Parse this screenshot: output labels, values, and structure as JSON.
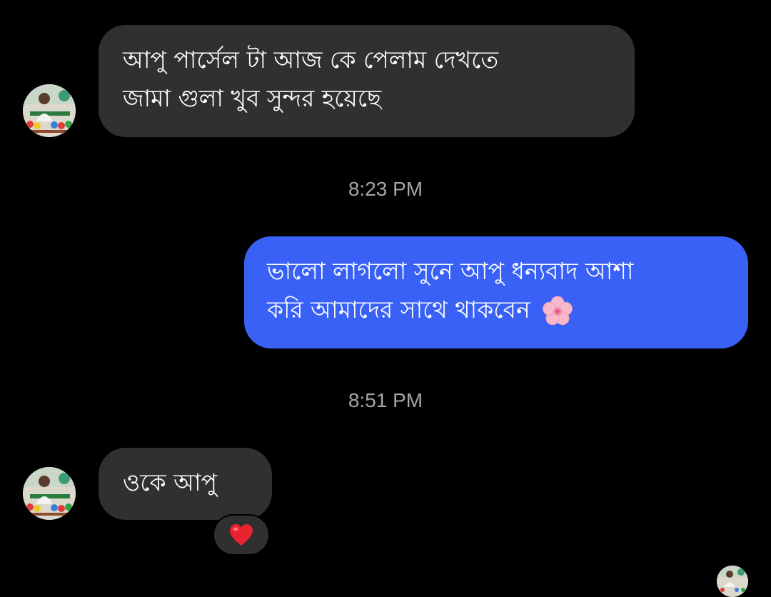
{
  "messages": [
    {
      "direction": "incoming",
      "lines": [
        "আপু পার্সেল টা আজ কে পেলাম  দেখতে",
        "জামা গুলা খুব সুন্দর হয়েছে"
      ]
    },
    {
      "direction": "outgoing",
      "lines": [
        "ভালো লাগলো সুনে আপু  ধন্যবাদ আশা",
        "করি আমাদের সাথে থাকবেন"
      ],
      "emoji": "cherry-blossom-icon"
    },
    {
      "direction": "incoming",
      "lines": [
        "ওকে আপু"
      ],
      "reaction": "heart-icon"
    }
  ],
  "timestamps": [
    "8:23 PM",
    "8:51 PM"
  ],
  "colors": {
    "background": "#000000",
    "incoming_bubble": "#303030",
    "outgoing_bubble": "#3a61f5",
    "timestamp_text": "#a6a6a6",
    "heart": "#e8222e"
  }
}
